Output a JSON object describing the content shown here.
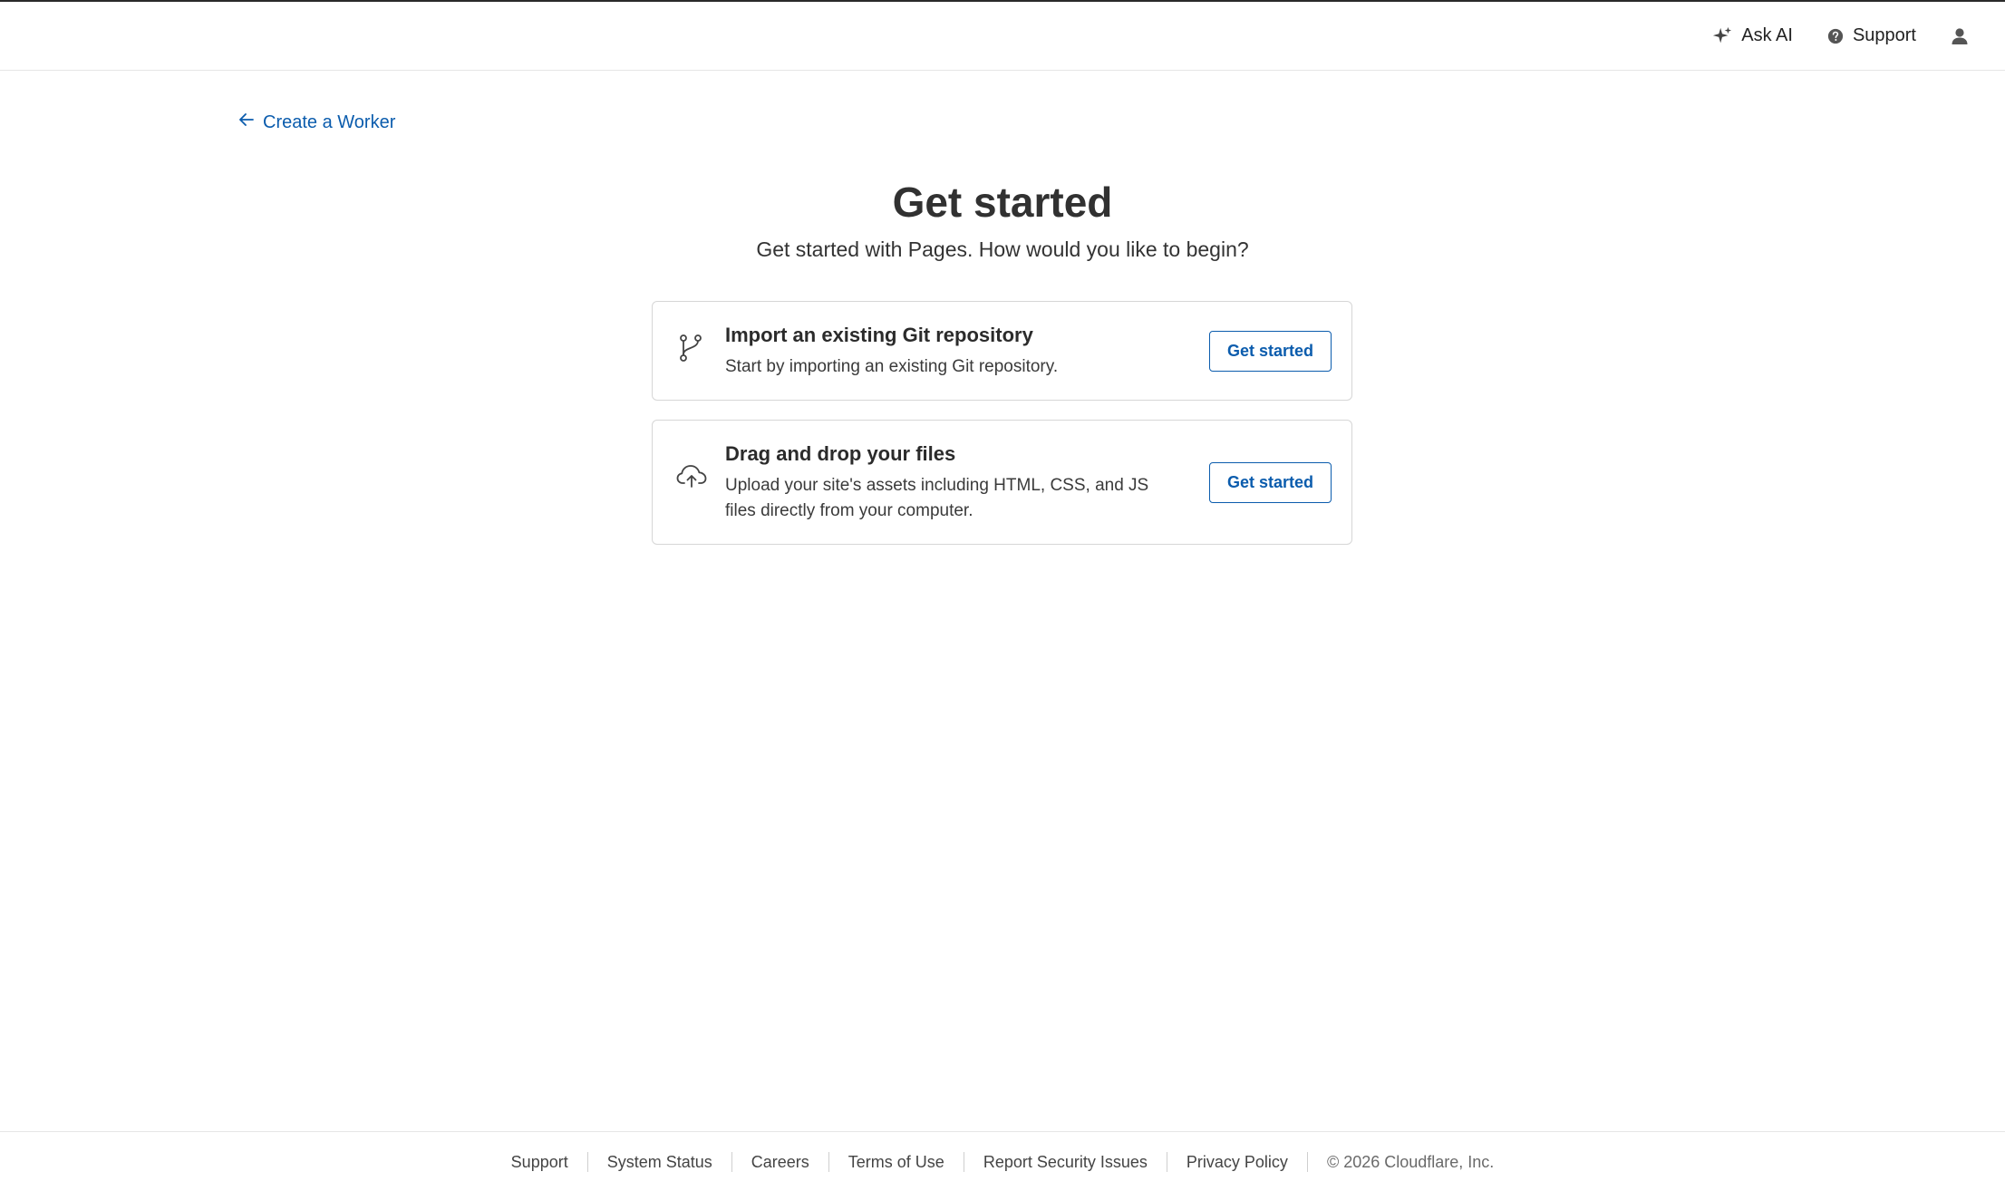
{
  "header": {
    "ask_ai_label": "Ask AI",
    "support_label": "Support"
  },
  "back_link": {
    "label": "Create a Worker"
  },
  "main": {
    "title": "Get started",
    "subtitle": "Get started with Pages. How would you like to begin?"
  },
  "options": [
    {
      "icon": "git-branch-icon",
      "title": "Import an existing Git repository",
      "description": "Start by importing an existing Git repository.",
      "button_label": "Get started"
    },
    {
      "icon": "cloud-upload-icon",
      "title": "Drag and drop your files",
      "description": "Upload your site's assets including HTML, CSS, and JS files directly from your computer.",
      "button_label": "Get started"
    }
  ],
  "footer": {
    "links": [
      "Support",
      "System Status",
      "Careers",
      "Terms of Use",
      "Report Security Issues",
      "Privacy Policy"
    ],
    "copyright": "© 2026 Cloudflare, Inc."
  },
  "colors": {
    "link_blue": "#0b5cad",
    "text_dark": "#313131",
    "border": "#d6d6d6"
  }
}
